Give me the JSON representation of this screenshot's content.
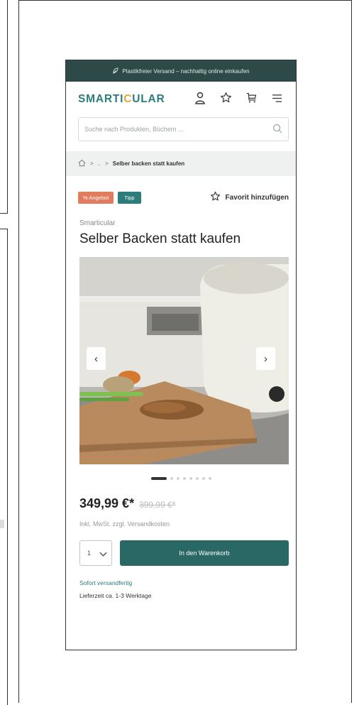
{
  "banner": {
    "icon": "leaf-icon",
    "text": "Plastikfreier Versand – nachhaltig online einkaufen"
  },
  "header": {
    "logo_part1": "SMARTI",
    "logo_accent": "C",
    "logo_part2": "ULAR",
    "icons": [
      "account-icon",
      "favorite-star-icon",
      "cart-icon",
      "menu-icon"
    ]
  },
  "search": {
    "placeholder": "Suche nach Produkten, Büchern ..."
  },
  "breadcrumb": {
    "sep": ">",
    "ellipsis": "..",
    "current": "Selber backen statt kaufen"
  },
  "tags": {
    "offer": "% Angebot",
    "tip": "Tipp"
  },
  "favorite": {
    "label": "Favorit hinzufügen"
  },
  "product": {
    "brand": "Smarticular",
    "title": "Selber Backen statt kaufen",
    "gallery": {
      "prev": "‹",
      "next": "›",
      "active_index": 1,
      "count": 8
    },
    "price": "349,99 €*",
    "old_price": "399,99 €*",
    "tax_note": "Inkl. MwSt. zzgl. Versandkosten",
    "quantity": "1",
    "add_to_cart": "In den Warenkorb",
    "stock": "Sofort versandfertig",
    "delivery": "Lieferzeit ca. 1-3 Werktage"
  },
  "colors": {
    "brand_teal": "#2a7d7a",
    "banner_bg": "#2d4a48",
    "cart_button": "#2a6866",
    "offer_tag": "#e27c5e",
    "logo_accent": "#e2a93b"
  }
}
